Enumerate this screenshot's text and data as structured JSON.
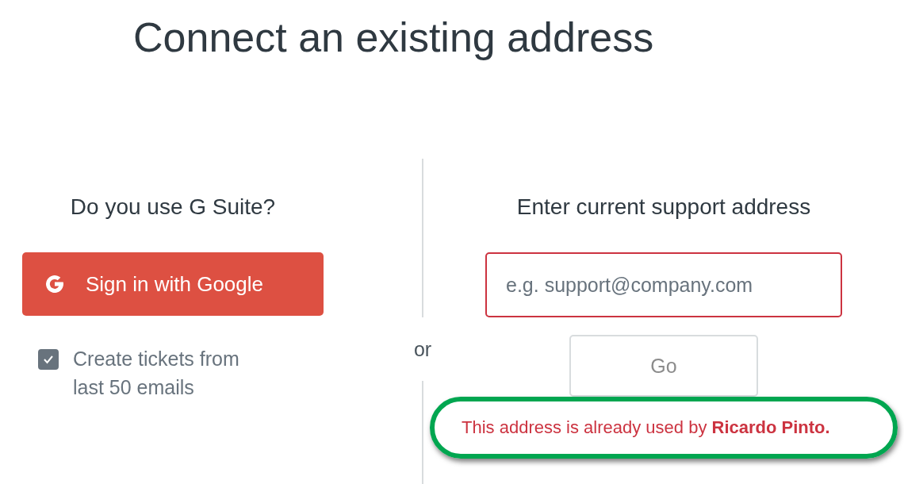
{
  "title": "Connect an existing address",
  "gsuite": {
    "heading": "Do you use G Suite?",
    "button": "Sign in with Google",
    "checkbox": {
      "label": "Create tickets from last 50 emails",
      "checked": true
    }
  },
  "separator": "or",
  "support": {
    "heading": "Enter current support address",
    "field": {
      "placeholder": "e.g. support@company.com",
      "invalid": true
    },
    "go_button": {
      "label": "Go",
      "disabled": true
    },
    "error": "This address is already used by **Ricardo Pinto.**"
  }
}
